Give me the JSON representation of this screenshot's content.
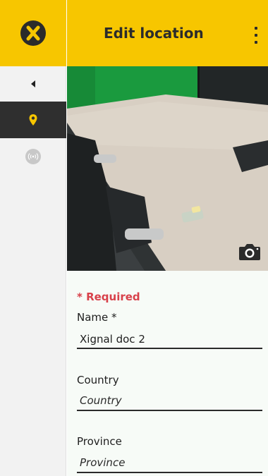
{
  "header": {
    "title": "Edit location"
  },
  "sidebar": {
    "items": [
      {
        "icon": "back-triangle-icon"
      },
      {
        "icon": "location-pin-icon",
        "active": true
      },
      {
        "icon": "wireless-signal-icon"
      }
    ]
  },
  "form": {
    "required_note": "* Required",
    "name_label": "Name *",
    "name_value": "Xignal doc 2",
    "country_label": "Country",
    "country_placeholder": "Country",
    "province_label": "Province",
    "province_placeholder": "Province"
  },
  "colors": {
    "brand_yellow": "#f7c600",
    "required_red": "#d8414a",
    "sidebar_active": "#2f2f2f"
  }
}
